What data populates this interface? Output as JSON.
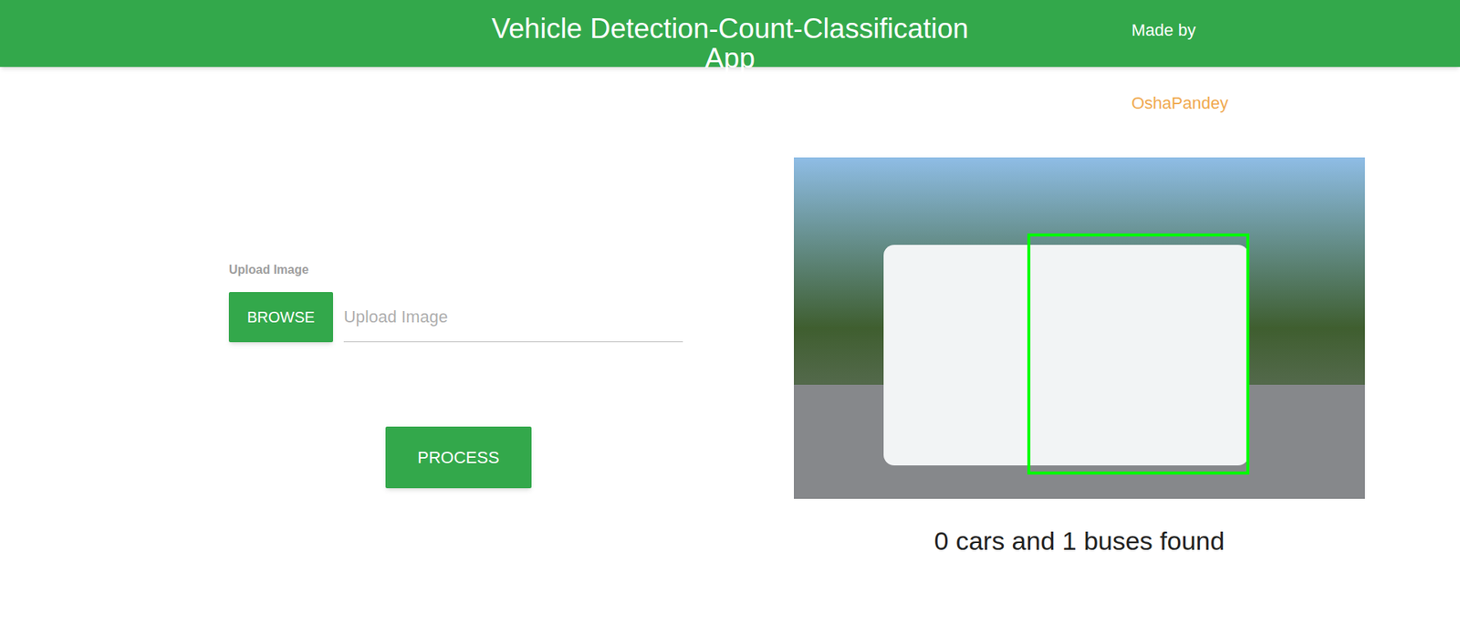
{
  "header": {
    "title": "Vehicle Detection-Count-Classification App",
    "credit_label": "Made by",
    "author": "OshaPandey"
  },
  "upload": {
    "label": "Upload Image",
    "browse_button": "BROWSE",
    "placeholder": "Upload Image"
  },
  "process_button": "PROCESS",
  "result": {
    "caption": "0 cars and 1 buses found"
  }
}
